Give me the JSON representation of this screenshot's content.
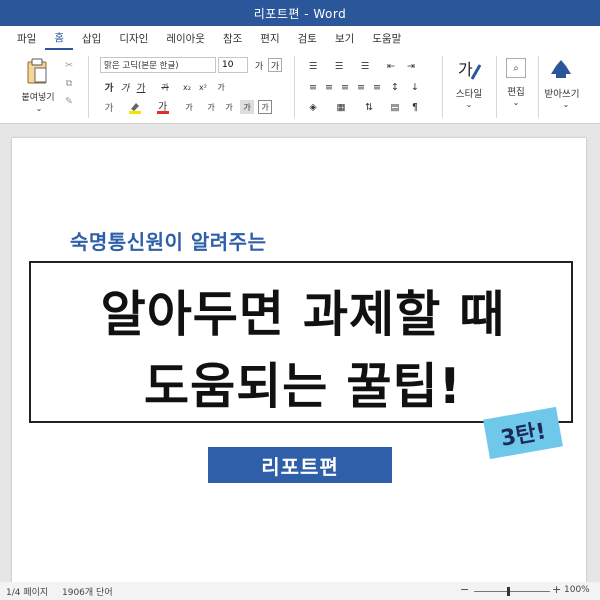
{
  "window": {
    "title": "리포트편 - Word"
  },
  "menu": {
    "tabs": [
      "파일",
      "홈",
      "삽입",
      "디자인",
      "레이아웃",
      "참조",
      "편지",
      "검토",
      "보기",
      "도움말"
    ],
    "active_index": 1
  },
  "ribbon": {
    "paste_label": "붙여넣기",
    "font_name": "맑은 고딕(본문 한글)",
    "font_size": "10",
    "style_label": "스타일",
    "edit_label": "편집",
    "read_aloud_label": "받아쓰기",
    "colors": {
      "highlight": "#f2e600",
      "font_color": "#e0302b",
      "accent": "#2b579a"
    }
  },
  "document": {
    "subtitle": "숙명통신원이 알려주는",
    "headline_line1": "알아두면 과제할 때",
    "headline_line2": "도움되는 꿀팁!",
    "badge": "3탄!",
    "tag": "리포트편",
    "colors": {
      "blue": "#2f5fa8",
      "badge": "#6fc8ea"
    }
  },
  "status": {
    "page": "1/4 페이지",
    "words": "1906개 단어",
    "zoom_minus": "−",
    "zoom_plus": "+",
    "zoom": "100%"
  }
}
